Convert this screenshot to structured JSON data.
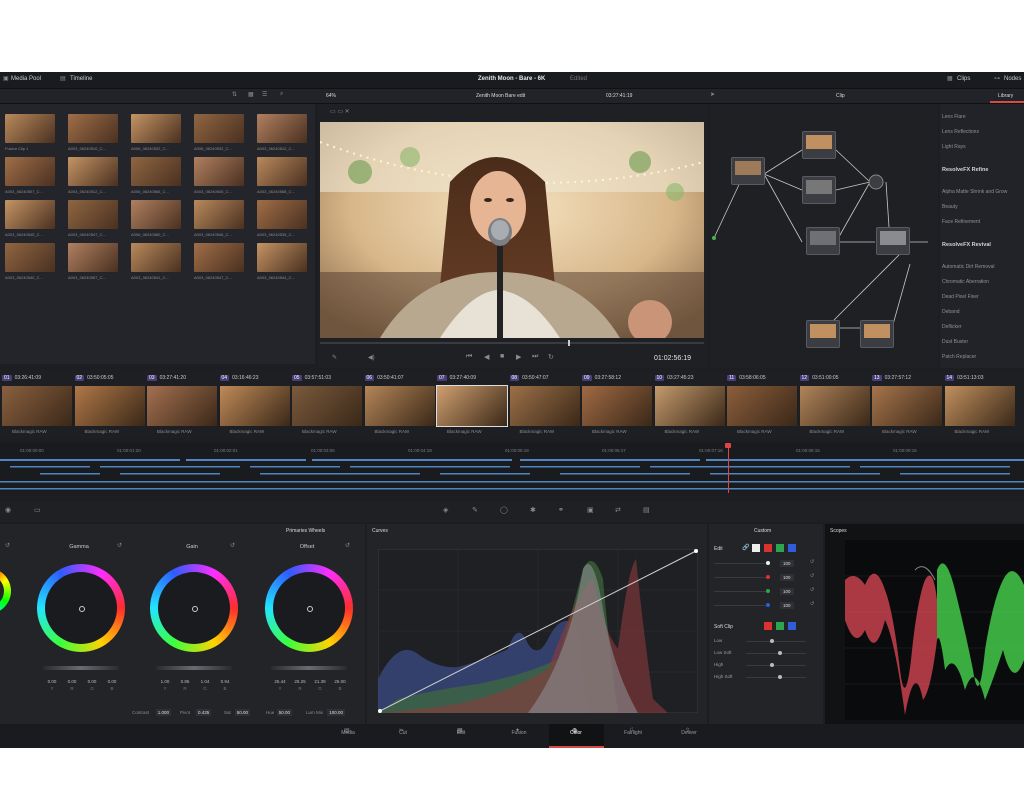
{
  "header": {
    "media_pool": "Media Pool",
    "timeline": "Timeline",
    "title": "Zenith Moon - Bare - 6K",
    "title_status": "Edited",
    "clips": "Clips",
    "nodes": "Nodes"
  },
  "viewer": {
    "zoom": "64%",
    "timeline_name": "Zenith Moon Bare edit",
    "timecode_top": "03:27:41:19",
    "timecode": "01:02:56:19",
    "clip_label": "Clip"
  },
  "media_pool": {
    "clips": [
      "Fusion Clip 1",
      "A003_06240510_C...",
      "A006_06240532_C...",
      "A006_06240532_C...",
      "A003_06240512_C...",
      "A003_06240507_C...",
      "A003_06240512_C...",
      "A006_06240566_C...",
      "A003_06240545_C...",
      "A003_06240568_C...",
      "A003_06240545_C...",
      "A003_06240547_C...",
      "A006_06240580_C...",
      "A003_06240546_C...",
      "A003_06240535_C...",
      "A003_06240540_C...",
      "A003_06240557_C...",
      "A003_06240541_C...",
      "A003_06240547_C...",
      "A003_06240544_C..."
    ]
  },
  "library": {
    "tab": "Library",
    "items_top": [
      "Lens Flare",
      "Lens Reflections",
      "Light Rays"
    ],
    "section1": "ResolveFX Refine",
    "items_refine": [
      "Alpha Matte Shrink and Grow",
      "Beauty",
      "Face Refinement"
    ],
    "section2": "ResolveFX Revival",
    "items_revival": [
      "Automatic Dirt Removal",
      "Chromatic Aberration",
      "Dead Pixel Fixer",
      "Deband",
      "Deflicker",
      "Dust Buster",
      "Patch Replacer"
    ]
  },
  "timeline": {
    "clips": [
      {
        "num": "01",
        "tc": "03:26:41:09",
        "name": "Blackmagic RAW"
      },
      {
        "num": "02",
        "tc": "03:50:05:05",
        "name": "Blackmagic RAW"
      },
      {
        "num": "03",
        "tc": "03:27:41:20",
        "name": "Blackmagic RAW"
      },
      {
        "num": "04",
        "tc": "03:16:46:23",
        "name": "Blackmagic RAW"
      },
      {
        "num": "05",
        "tc": "03:57:51:03",
        "name": "Blackmagic RAW"
      },
      {
        "num": "06",
        "tc": "03:50:41:07",
        "name": "Blackmagic RAW"
      },
      {
        "num": "07",
        "tc": "03:27:40:09",
        "name": "Blackmagic RAW"
      },
      {
        "num": "08",
        "tc": "03:50:47:07",
        "name": "Blackmagic RAW"
      },
      {
        "num": "09",
        "tc": "03:27:58:12",
        "name": "Blackmagic RAW"
      },
      {
        "num": "10",
        "tc": "03:27:45:23",
        "name": "Blackmagic RAW"
      },
      {
        "num": "11",
        "tc": "03:58:06:05",
        "name": "Blackmagic RAW"
      },
      {
        "num": "12",
        "tc": "03:51:00:05",
        "name": "Blackmagic RAW"
      },
      {
        "num": "13",
        "tc": "03:27:57:12",
        "name": "Blackmagic RAW"
      },
      {
        "num": "14",
        "tc": "03:51:13:03",
        "name": "Blackmagic RAW"
      }
    ],
    "ruler": [
      "01:00:00:00",
      "01:00:01:20",
      "01:00:02:01",
      "01:00:03:06",
      "01:00:04:18",
      "01:00:05:18",
      "01:00:06:17",
      "01:00:07:16",
      "01:00:08:15",
      "01:00:09:15"
    ]
  },
  "primaries": {
    "title": "Primaries Wheels",
    "wheels": [
      {
        "label": "Gamma",
        "values": [
          "0.00",
          "0.00",
          "0.00",
          "0.00"
        ]
      },
      {
        "label": "Gain",
        "values": [
          "1.00",
          "0.85",
          "1.04",
          "0.94"
        ]
      },
      {
        "label": "Offset",
        "values": [
          "25.44",
          "25.25",
          "21.39",
          "25.00"
        ]
      }
    ],
    "channels": [
      "Y",
      "R",
      "G",
      "B"
    ],
    "params": [
      {
        "label": "Contrast",
        "value": "1.000"
      },
      {
        "label": "Pivot",
        "value": "0.435"
      },
      {
        "label": "Sat",
        "value": "50.00"
      },
      {
        "label": "Hue",
        "value": "50.00"
      },
      {
        "label": "Lum Mix",
        "value": "100.00"
      }
    ]
  },
  "curves": {
    "title": "Curves",
    "mode": "Custom"
  },
  "edit_panel": {
    "title": "Edit",
    "values": [
      "100",
      "100",
      "100",
      "100"
    ],
    "soft_clip": "Soft Clip",
    "soft_items": [
      "Low",
      "Low Soft",
      "High",
      "High Soft"
    ]
  },
  "scopes": {
    "title": "Scopes"
  },
  "pages": [
    "Media",
    "Cut",
    "Edit",
    "Fusion",
    "Color",
    "Fairlight",
    "Deliver"
  ]
}
